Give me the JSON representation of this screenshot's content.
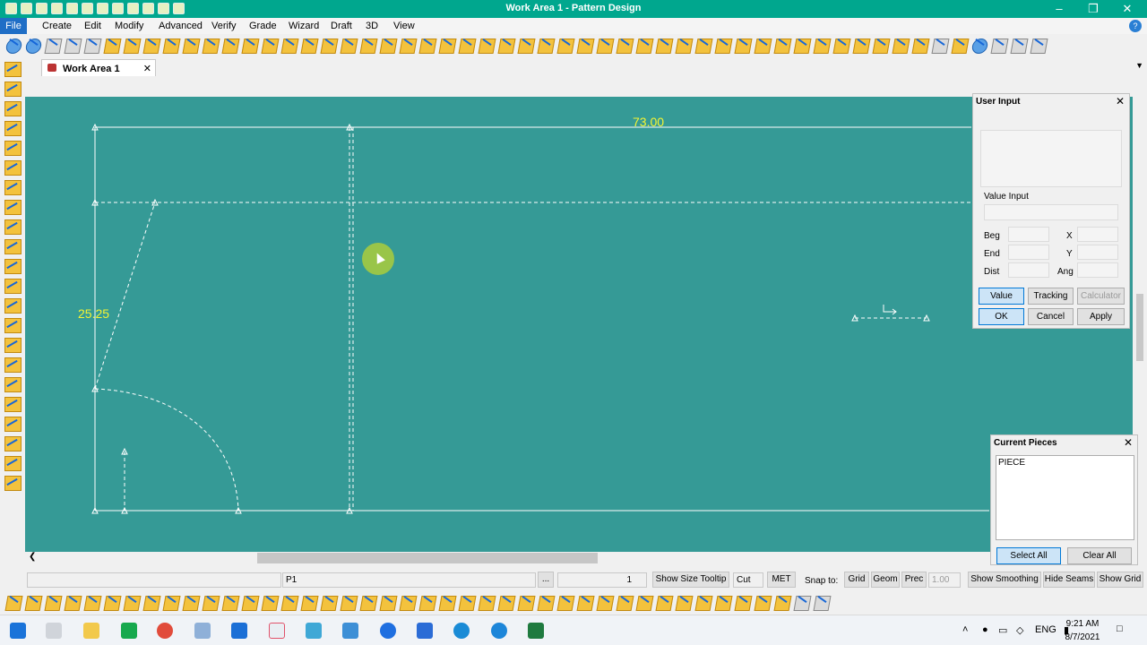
{
  "window": {
    "title": "Work Area 1 - Pattern Design",
    "minimize": "–",
    "maximize": "❐",
    "close": "✕"
  },
  "menu": {
    "file": "File",
    "items": [
      "Create",
      "Edit",
      "Modify",
      "Advanced",
      "Verify",
      "Grade",
      "Wizard",
      "Draft",
      "3D",
      "View"
    ],
    "help": "?"
  },
  "tab": {
    "label": "Work Area 1",
    "close": "✕",
    "dropdown": "▼"
  },
  "canvas": {
    "background": "#359a96",
    "line_color": "#ffffff",
    "dimension_color": "#f4f433",
    "dimensions": {
      "width_label": "73.00",
      "height_label": "25.25"
    }
  },
  "user_input": {
    "title": "User Input",
    "close": "✕",
    "value_input_label": "Value Input",
    "labels": {
      "beg": "Beg",
      "end": "End",
      "dist": "Dist",
      "x": "X",
      "y": "Y",
      "ang": "Ang"
    },
    "mode_buttons": {
      "value": "Value",
      "tracking": "Tracking",
      "calculator": "Calculator"
    },
    "action_buttons": {
      "ok": "OK",
      "cancel": "Cancel",
      "apply": "Apply"
    }
  },
  "current_pieces": {
    "title": "Current Pieces",
    "close": "✕",
    "items": [
      "PIECE"
    ],
    "select_all": "Select All",
    "clear_all": "Clear All"
  },
  "status": {
    "point": "P1",
    "browse": "...",
    "count": "1",
    "show_size_tooltip": "Show Size Tooltip",
    "cut": "Cut",
    "units": "MET",
    "snap_label": "Snap to:",
    "grid": "Grid",
    "geom": "Geom",
    "prec": "Prec",
    "prec_value": "1.00",
    "show_smoothing": "Show Smoothing",
    "hide_seams": "Hide Seams",
    "show_grid": "Show Grid"
  },
  "taskbar": {
    "time": "9:21 AM",
    "date": "8/7/2021",
    "language": "ENG"
  }
}
